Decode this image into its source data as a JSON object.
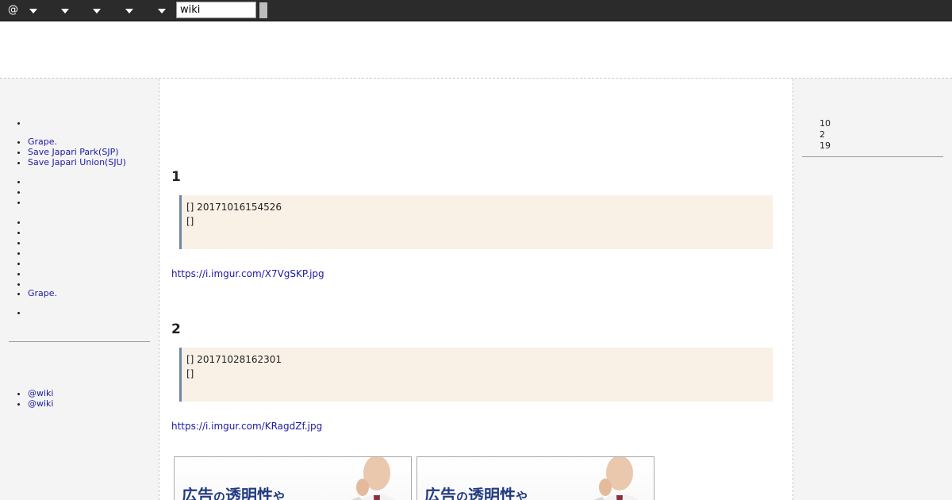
{
  "topbar": {
    "at_label": "@",
    "search_value": "wiki"
  },
  "left_sidebar": {
    "group1": [
      ""
    ],
    "group2": [
      "Grape.",
      "Save Japari Park(SJP)",
      "Save Japari Union(SJU)"
    ],
    "group3": [
      "",
      "",
      ""
    ],
    "group4": [
      "",
      "",
      "",
      "",
      "",
      "",
      ""
    ],
    "group5": [
      "Grape."
    ],
    "group6": [
      ""
    ],
    "bottom_links": [
      "@wiki",
      "@wiki"
    ]
  },
  "main": {
    "sections": [
      {
        "heading": "1",
        "quote_line1": "[] 20171016154526",
        "quote_line2": "[]",
        "link": "https://i.imgur.com/X7VgSKP.jpg"
      },
      {
        "heading": "2",
        "quote_line1": "[] 20171028162301",
        "quote_line2": "[]",
        "link": "https://i.imgur.com/KRagdZf.jpg"
      }
    ],
    "ads": [
      {
        "text_a": "広告",
        "text_b": "の",
        "text_c": "透明性",
        "text_d": "や"
      },
      {
        "text_a": "広告",
        "text_b": "の",
        "text_c": "透明性",
        "text_d": "や"
      }
    ]
  },
  "right_sidebar": {
    "counts": [
      "10",
      "2",
      "19"
    ]
  },
  "colors": {
    "topbar_bg": "#2b2b2b",
    "link": "#1a1aa6",
    "quote_bg": "#f9f1e6",
    "quote_border": "#6f86a6",
    "ad_text": "#223a80"
  }
}
